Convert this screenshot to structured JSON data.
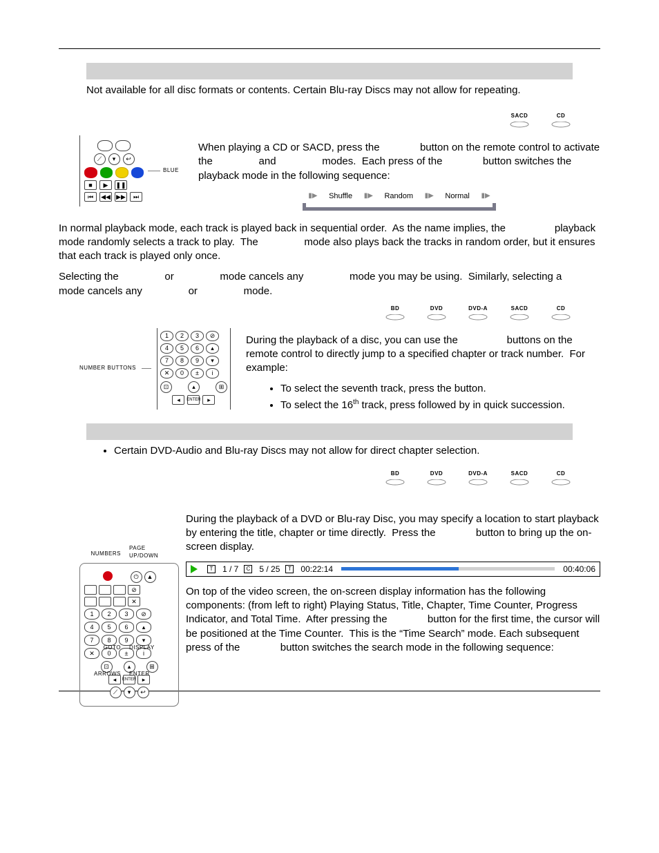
{
  "note1": {
    "text": "Not available for all disc formats or contents.  Certain Blu-ray Discs may not allow for repeating."
  },
  "formats": {
    "sacd": "SACD",
    "cd": "CD",
    "bd": "BD",
    "dvd": "DVD",
    "dvda": "DVD-A"
  },
  "shuffle": {
    "callout": "BLUE",
    "para": "When playing a CD or SACD, press the              button on the remote control to activate the                and                modes.  Each press of the              button switches the playback mode in the following sequence:",
    "seq": {
      "a": "Shuffle",
      "b": "Random",
      "c": "Normal"
    },
    "body1": "In normal playback mode, each track is played back in sequential order.  As the name implies, the                 playback mode randomly selects a track to play.  The                mode also plays back the tracks in random order, but it ensures that each track is played only once.",
    "body2": "Selecting the                or                mode cancels any                mode you may be using.  Similarly, selecting a                mode cancels any                or                mode."
  },
  "numbers": {
    "callout": "NUMBER\nBUTTONS",
    "para": "During the playback of a disc, you can use the                 buttons on the remote control to directly jump to a specified chapter or track number.  For example:",
    "bullet1a": "To select the seventh track, press the ",
    "bullet1b": " button.",
    "bullet2a": "To select the 16",
    "bullet2sup": "th",
    "bullet2b": " track, press        followed by        in quick succession."
  },
  "note2": {
    "bullet": "Certain DVD-Audio and Blu-ray Discs may not allow for direct chapter selection."
  },
  "goto": {
    "labels": {
      "numbers": "NUMBERS",
      "goto": "GOTO",
      "arrows": "ARROWS",
      "pageupdown": "PAGE\nUP/DOWN",
      "display": "DISPLAY",
      "enter": "ENTER"
    },
    "para1": "During the playback of a DVD or Blu-ray Disc, you may specify a location to start playback by entering the title, chapter or time directly.  Press the              button to bring up the on-screen display.",
    "osd": {
      "title": "1 / 7",
      "chapter": "5 / 25",
      "elapsed": "00:22:14",
      "total": "00:40:06"
    },
    "para2": "On top of the video screen, the on-screen display information has the following components: (from left to right) Playing Status, Title, Chapter, Time Counter, Progress Indicator, and Total Time.  After pressing the              button for the first time, the cursor will be positioned at the Time Counter.  This is the “Time Search” mode. Each subsequent press of the              button switches the search mode in the following sequence:"
  }
}
